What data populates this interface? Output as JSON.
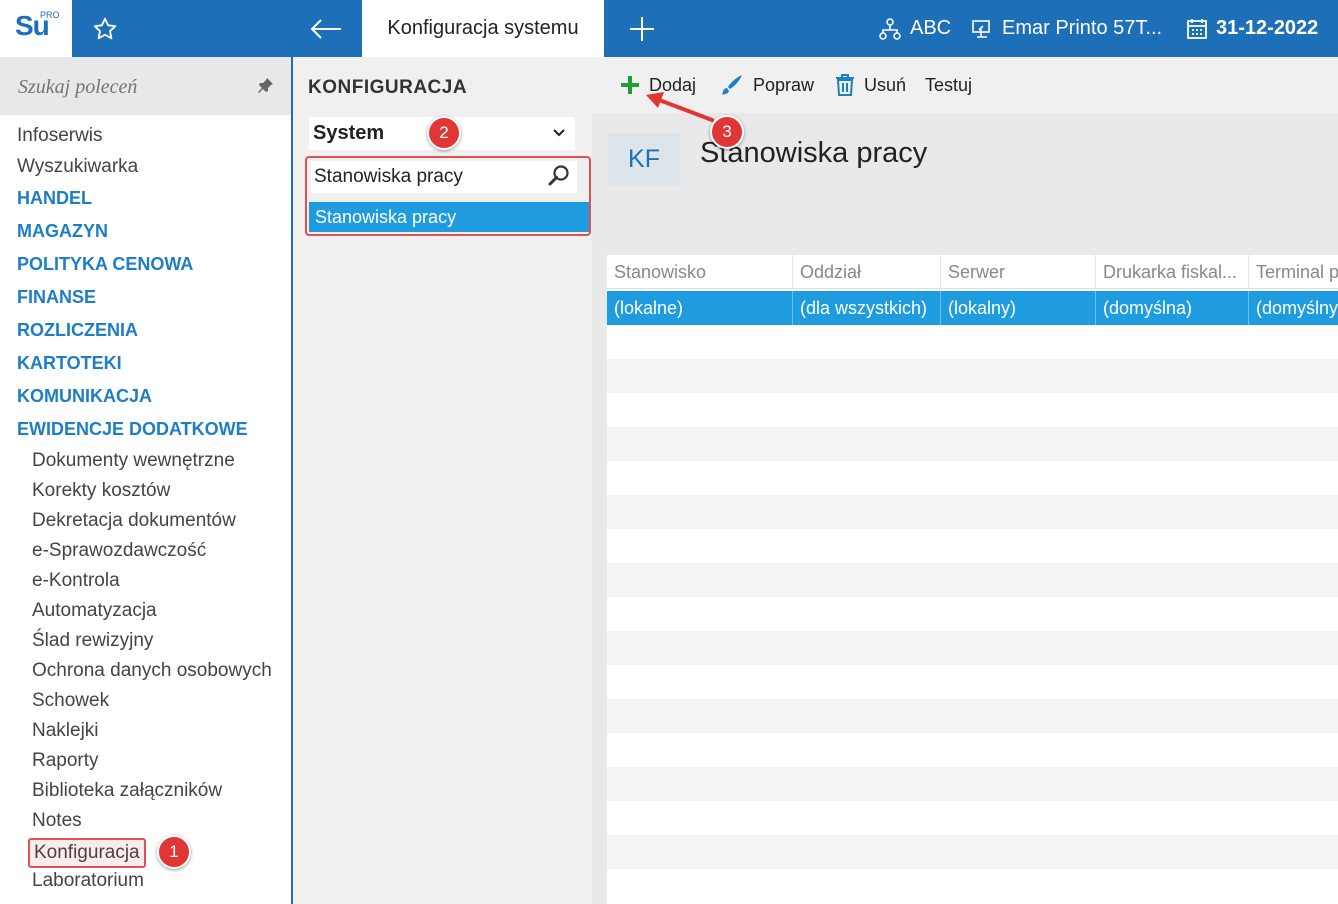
{
  "app": {
    "logo_text": "Su",
    "logo_sup": "PRO",
    "active_tab": "Konfiguracja systemu",
    "company": "ABC",
    "workstation": "Emar Printo 57T...",
    "date": "31-12-2022"
  },
  "sidebar": {
    "search_placeholder": "Szukaj poleceń",
    "items": [
      {
        "label": "Infoserwis"
      },
      {
        "label": "Wyszukiwarka"
      },
      {
        "label": "HANDEL"
      },
      {
        "label": "MAGAZYN"
      },
      {
        "label": "POLITYKA CENOWA"
      },
      {
        "label": "FINANSE"
      },
      {
        "label": "ROZLICZENIA"
      },
      {
        "label": "KARTOTEKI"
      },
      {
        "label": "KOMUNIKACJA"
      },
      {
        "label": "EWIDENCJE DODATKOWE"
      },
      {
        "label": "Dokumenty wewnętrzne"
      },
      {
        "label": "Korekty kosztów"
      },
      {
        "label": "Dekretacja dokumentów"
      },
      {
        "label": "e-Sprawozdawczość"
      },
      {
        "label": "e-Kontrola"
      },
      {
        "label": "Automatyzacja"
      },
      {
        "label": "Ślad rewizyjny"
      },
      {
        "label": "Ochrona danych osobowych"
      },
      {
        "label": "Schowek"
      },
      {
        "label": "Naklejki"
      },
      {
        "label": "Raporty"
      },
      {
        "label": "Biblioteka załączników"
      },
      {
        "label": "Notes"
      },
      {
        "label": "Konfiguracja"
      },
      {
        "label": "Laboratorium"
      }
    ]
  },
  "middle": {
    "title": "KONFIGURACJA",
    "selected_group": "System",
    "filter_value": "Stanowiska pracy",
    "filter_result": "Stanowiska pracy"
  },
  "toolbar": {
    "add_label": "Dodaj",
    "edit_label": "Popraw",
    "delete_label": "Usuń",
    "test_label": "Testuj"
  },
  "content": {
    "badge": "KF",
    "title": "Stanowiska pracy",
    "columns": [
      "Stanowisko",
      "Oddział",
      "Serwer",
      "Drukarka fiskal...",
      "Terminal p"
    ],
    "rows": [
      [
        "(lokalne)",
        "(dla wszystkich)",
        "(lokalny)",
        "(domyślna)",
        "(domyślny"
      ]
    ]
  },
  "callouts": {
    "one": "1",
    "two": "2",
    "three": "3"
  },
  "colors": {
    "brand": "#1d6fb8",
    "selection": "#1f9be0",
    "callout": "#e03636",
    "add_icon": "#1e9e3a"
  }
}
